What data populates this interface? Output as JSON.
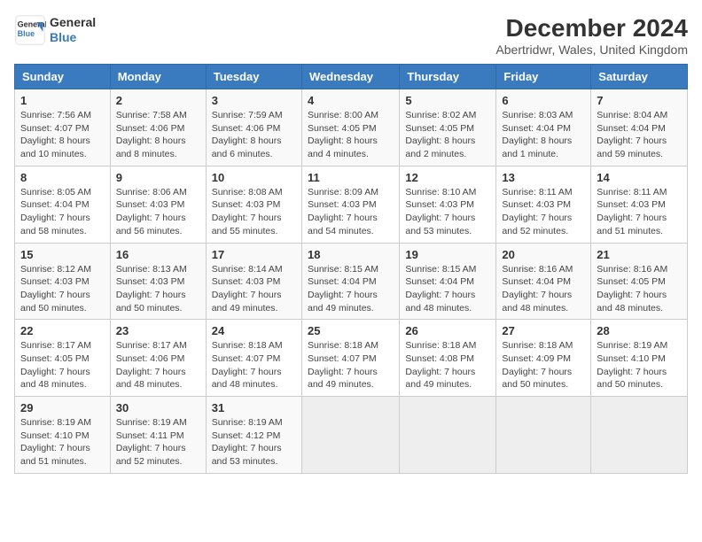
{
  "header": {
    "logo_line1": "General",
    "logo_line2": "Blue",
    "title": "December 2024",
    "subtitle": "Abertridwr, Wales, United Kingdom"
  },
  "calendar": {
    "weekdays": [
      "Sunday",
      "Monday",
      "Tuesday",
      "Wednesday",
      "Thursday",
      "Friday",
      "Saturday"
    ],
    "weeks": [
      [
        {
          "day": "1",
          "info": "Sunrise: 7:56 AM\nSunset: 4:07 PM\nDaylight: 8 hours and 10 minutes."
        },
        {
          "day": "2",
          "info": "Sunrise: 7:58 AM\nSunset: 4:06 PM\nDaylight: 8 hours and 8 minutes."
        },
        {
          "day": "3",
          "info": "Sunrise: 7:59 AM\nSunset: 4:06 PM\nDaylight: 8 hours and 6 minutes."
        },
        {
          "day": "4",
          "info": "Sunrise: 8:00 AM\nSunset: 4:05 PM\nDaylight: 8 hours and 4 minutes."
        },
        {
          "day": "5",
          "info": "Sunrise: 8:02 AM\nSunset: 4:05 PM\nDaylight: 8 hours and 2 minutes."
        },
        {
          "day": "6",
          "info": "Sunrise: 8:03 AM\nSunset: 4:04 PM\nDaylight: 8 hours and 1 minute."
        },
        {
          "day": "7",
          "info": "Sunrise: 8:04 AM\nSunset: 4:04 PM\nDaylight: 7 hours and 59 minutes."
        }
      ],
      [
        {
          "day": "8",
          "info": "Sunrise: 8:05 AM\nSunset: 4:04 PM\nDaylight: 7 hours and 58 minutes."
        },
        {
          "day": "9",
          "info": "Sunrise: 8:06 AM\nSunset: 4:03 PM\nDaylight: 7 hours and 56 minutes."
        },
        {
          "day": "10",
          "info": "Sunrise: 8:08 AM\nSunset: 4:03 PM\nDaylight: 7 hours and 55 minutes."
        },
        {
          "day": "11",
          "info": "Sunrise: 8:09 AM\nSunset: 4:03 PM\nDaylight: 7 hours and 54 minutes."
        },
        {
          "day": "12",
          "info": "Sunrise: 8:10 AM\nSunset: 4:03 PM\nDaylight: 7 hours and 53 minutes."
        },
        {
          "day": "13",
          "info": "Sunrise: 8:11 AM\nSunset: 4:03 PM\nDaylight: 7 hours and 52 minutes."
        },
        {
          "day": "14",
          "info": "Sunrise: 8:11 AM\nSunset: 4:03 PM\nDaylight: 7 hours and 51 minutes."
        }
      ],
      [
        {
          "day": "15",
          "info": "Sunrise: 8:12 AM\nSunset: 4:03 PM\nDaylight: 7 hours and 50 minutes."
        },
        {
          "day": "16",
          "info": "Sunrise: 8:13 AM\nSunset: 4:03 PM\nDaylight: 7 hours and 50 minutes."
        },
        {
          "day": "17",
          "info": "Sunrise: 8:14 AM\nSunset: 4:03 PM\nDaylight: 7 hours and 49 minutes."
        },
        {
          "day": "18",
          "info": "Sunrise: 8:15 AM\nSunset: 4:04 PM\nDaylight: 7 hours and 49 minutes."
        },
        {
          "day": "19",
          "info": "Sunrise: 8:15 AM\nSunset: 4:04 PM\nDaylight: 7 hours and 48 minutes."
        },
        {
          "day": "20",
          "info": "Sunrise: 8:16 AM\nSunset: 4:04 PM\nDaylight: 7 hours and 48 minutes."
        },
        {
          "day": "21",
          "info": "Sunrise: 8:16 AM\nSunset: 4:05 PM\nDaylight: 7 hours and 48 minutes."
        }
      ],
      [
        {
          "day": "22",
          "info": "Sunrise: 8:17 AM\nSunset: 4:05 PM\nDaylight: 7 hours and 48 minutes."
        },
        {
          "day": "23",
          "info": "Sunrise: 8:17 AM\nSunset: 4:06 PM\nDaylight: 7 hours and 48 minutes."
        },
        {
          "day": "24",
          "info": "Sunrise: 8:18 AM\nSunset: 4:07 PM\nDaylight: 7 hours and 48 minutes."
        },
        {
          "day": "25",
          "info": "Sunrise: 8:18 AM\nSunset: 4:07 PM\nDaylight: 7 hours and 49 minutes."
        },
        {
          "day": "26",
          "info": "Sunrise: 8:18 AM\nSunset: 4:08 PM\nDaylight: 7 hours and 49 minutes."
        },
        {
          "day": "27",
          "info": "Sunrise: 8:18 AM\nSunset: 4:09 PM\nDaylight: 7 hours and 50 minutes."
        },
        {
          "day": "28",
          "info": "Sunrise: 8:19 AM\nSunset: 4:10 PM\nDaylight: 7 hours and 50 minutes."
        }
      ],
      [
        {
          "day": "29",
          "info": "Sunrise: 8:19 AM\nSunset: 4:10 PM\nDaylight: 7 hours and 51 minutes."
        },
        {
          "day": "30",
          "info": "Sunrise: 8:19 AM\nSunset: 4:11 PM\nDaylight: 7 hours and 52 minutes."
        },
        {
          "day": "31",
          "info": "Sunrise: 8:19 AM\nSunset: 4:12 PM\nDaylight: 7 hours and 53 minutes."
        },
        {
          "day": "",
          "info": ""
        },
        {
          "day": "",
          "info": ""
        },
        {
          "day": "",
          "info": ""
        },
        {
          "day": "",
          "info": ""
        }
      ]
    ]
  }
}
